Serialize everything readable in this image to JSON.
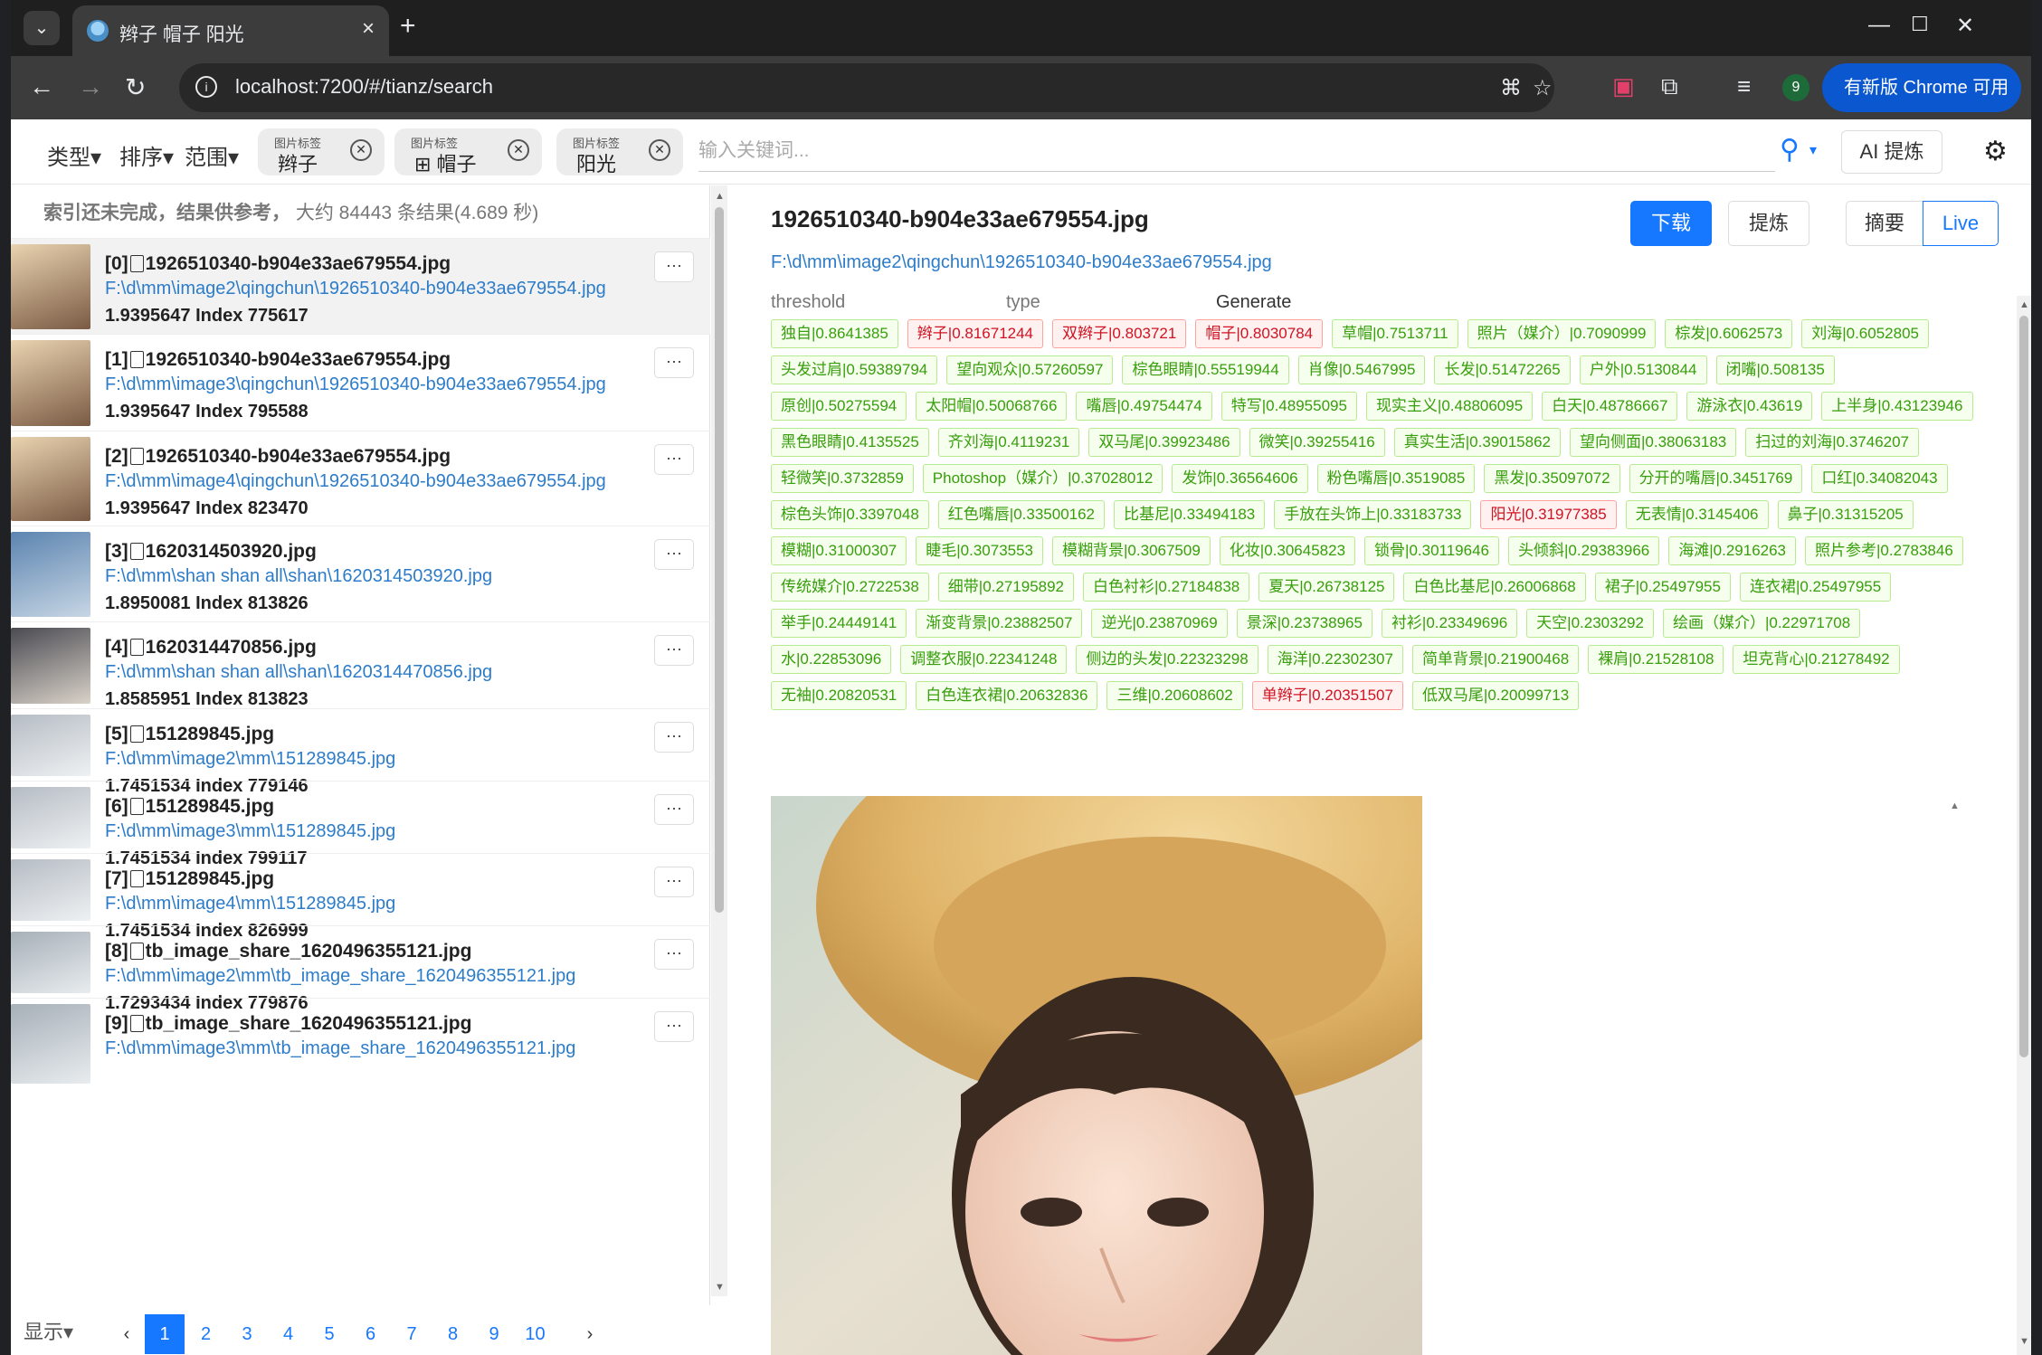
{
  "browser": {
    "tab_title": "辫子 帽子 阳光",
    "url": "localhost:7200/#/tianz/search",
    "update_label": "有新版 Chrome 可用",
    "profile_initial": "9"
  },
  "header": {
    "type_label": "类型",
    "sort_label": "排序",
    "range_label": "范围",
    "chips": [
      {
        "caption": "图片标签",
        "value": "辫子"
      },
      {
        "caption": "图片标签",
        "value": "⊞ 帽子"
      },
      {
        "caption": "图片标签",
        "value": "阳光"
      }
    ],
    "search_placeholder": "输入关键词...",
    "ai_label": "AI 提炼"
  },
  "left": {
    "status": "索引还未完成，结果供参考，",
    "status_count": "大约 84443 条结果(4.689 秒)",
    "results": [
      {
        "title": "[0]",
        "file": "1926510340-b904e33ae679554.jpg",
        "path": "F:\\d\\mm\\image2\\qingchun\\1926510340-b904e33ae679554.jpg",
        "score": "1.9395647 Index 775617"
      },
      {
        "title": "[1]",
        "file": "1926510340-b904e33ae679554.jpg",
        "path": "F:\\d\\mm\\image3\\qingchun\\1926510340-b904e33ae679554.jpg",
        "score": "1.9395647 Index 795588"
      },
      {
        "title": "[2]",
        "file": "1926510340-b904e33ae679554.jpg",
        "path": "F:\\d\\mm\\image4\\qingchun\\1926510340-b904e33ae679554.jpg",
        "score": "1.9395647 Index 823470"
      },
      {
        "title": "[3]",
        "file": "1620314503920.jpg",
        "path": "F:\\d\\mm\\shan shan all\\shan\\1620314503920.jpg",
        "score": "1.8950081 Index 813826"
      },
      {
        "title": "[4]",
        "file": "1620314470856.jpg",
        "path": "F:\\d\\mm\\shan shan all\\shan\\1620314470856.jpg",
        "score": "1.8585951 Index 813823"
      },
      {
        "title": "[5]",
        "file": "151289845.jpg",
        "path": "F:\\d\\mm\\image2\\mm\\151289845.jpg",
        "score": "1.7451534 Index 779146"
      },
      {
        "title": "[6]",
        "file": "151289845.jpg",
        "path": "F:\\d\\mm\\image3\\mm\\151289845.jpg",
        "score": "1.7451534 Index 799117"
      },
      {
        "title": "[7]",
        "file": "151289845.jpg",
        "path": "F:\\d\\mm\\image4\\mm\\151289845.jpg",
        "score": "1.7451534 Index 826999"
      },
      {
        "title": "[8]",
        "file": "tb_image_share_1620496355121.jpg",
        "path": "F:\\d\\mm\\image2\\mm\\tb_image_share_1620496355121.jpg",
        "score": "1.7293434 Index 779876"
      },
      {
        "title": "[9]",
        "file": "tb_image_share_1620496355121.jpg",
        "path": "F:\\d\\mm\\image3\\mm\\tb_image_share_1620496355121.jpg",
        "score": ""
      }
    ],
    "more_label": "···",
    "show_label": "显示",
    "pages": [
      "1",
      "2",
      "3",
      "4",
      "5",
      "6",
      "7",
      "8",
      "9",
      "10"
    ]
  },
  "detail": {
    "title": "1926510340-b904e33ae679554.jpg",
    "path": "F:\\d\\mm\\image2\\qingchun\\1926510340-b904e33ae679554.jpg",
    "download_label": "下载",
    "extract_label": "提炼",
    "summary_label": "摘要",
    "live_label": "Live",
    "col_threshold": "threshold",
    "col_type": "type",
    "col_generate": "Generate",
    "tags": [
      {
        "t": "独自|0.8641385",
        "r": false
      },
      {
        "t": "辫子|0.81671244",
        "r": true
      },
      {
        "t": "双辫子|0.803721",
        "r": true
      },
      {
        "t": "帽子|0.8030784",
        "r": true
      },
      {
        "t": "草帽|0.7513711",
        "r": false
      },
      {
        "t": "照片（媒介）|0.7090999",
        "r": false
      },
      {
        "t": "棕发|0.6062573",
        "r": false
      },
      {
        "t": "刘海|0.6052805",
        "r": false
      },
      {
        "t": "头发过肩|0.59389794",
        "r": false
      },
      {
        "t": "望向观众|0.57260597",
        "r": false
      },
      {
        "t": "棕色眼睛|0.55519944",
        "r": false
      },
      {
        "t": "肖像|0.5467995",
        "r": false
      },
      {
        "t": "长发|0.51472265",
        "r": false
      },
      {
        "t": "户外|0.5130844",
        "r": false
      },
      {
        "t": "闭嘴|0.508135",
        "r": false
      },
      {
        "t": "原创|0.50275594",
        "r": false
      },
      {
        "t": "太阳帽|0.50068766",
        "r": false
      },
      {
        "t": "嘴唇|0.49754474",
        "r": false
      },
      {
        "t": "特写|0.48955095",
        "r": false
      },
      {
        "t": "现实主义|0.48806095",
        "r": false
      },
      {
        "t": "白天|0.48786667",
        "r": false
      },
      {
        "t": "游泳衣|0.43619",
        "r": false
      },
      {
        "t": "上半身|0.43123946",
        "r": false
      },
      {
        "t": "黑色眼睛|0.4135525",
        "r": false
      },
      {
        "t": "齐刘海|0.4119231",
        "r": false
      },
      {
        "t": "双马尾|0.39923486",
        "r": false
      },
      {
        "t": "微笑|0.39255416",
        "r": false
      },
      {
        "t": "真实生活|0.39015862",
        "r": false
      },
      {
        "t": "望向侧面|0.38063183",
        "r": false
      },
      {
        "t": "扫过的刘海|0.3746207",
        "r": false
      },
      {
        "t": "轻微笑|0.3732859",
        "r": false
      },
      {
        "t": "Photoshop（媒介）|0.37028012",
        "r": false
      },
      {
        "t": "发饰|0.36564606",
        "r": false
      },
      {
        "t": "粉色嘴唇|0.3519085",
        "r": false
      },
      {
        "t": "黑发|0.35097072",
        "r": false
      },
      {
        "t": "分开的嘴唇|0.3451769",
        "r": false
      },
      {
        "t": "口红|0.34082043",
        "r": false
      },
      {
        "t": "棕色头饰|0.3397048",
        "r": false
      },
      {
        "t": "红色嘴唇|0.33500162",
        "r": false
      },
      {
        "t": "比基尼|0.33494183",
        "r": false
      },
      {
        "t": "手放在头饰上|0.33183733",
        "r": false
      },
      {
        "t": "阳光|0.31977385",
        "r": true
      },
      {
        "t": "无表情|0.3145406",
        "r": false
      },
      {
        "t": "鼻子|0.31315205",
        "r": false
      },
      {
        "t": "模糊|0.31000307",
        "r": false
      },
      {
        "t": "睫毛|0.3073553",
        "r": false
      },
      {
        "t": "模糊背景|0.3067509",
        "r": false
      },
      {
        "t": "化妆|0.30645823",
        "r": false
      },
      {
        "t": "锁骨|0.30119646",
        "r": false
      },
      {
        "t": "头倾斜|0.29383966",
        "r": false
      },
      {
        "t": "海滩|0.2916263",
        "r": false
      },
      {
        "t": "照片参考|0.2783846",
        "r": false
      },
      {
        "t": "传统媒介|0.2722538",
        "r": false
      },
      {
        "t": "细带|0.27195892",
        "r": false
      },
      {
        "t": "白色衬衫|0.27184838",
        "r": false
      },
      {
        "t": "夏天|0.26738125",
        "r": false
      },
      {
        "t": "白色比基尼|0.26006868",
        "r": false
      },
      {
        "t": "裙子|0.25497955",
        "r": false
      },
      {
        "t": "连衣裙|0.25497955",
        "r": false
      },
      {
        "t": "举手|0.24449141",
        "r": false
      },
      {
        "t": "渐变背景|0.23882507",
        "r": false
      },
      {
        "t": "逆光|0.23870969",
        "r": false
      },
      {
        "t": "景深|0.23738965",
        "r": false
      },
      {
        "t": "衬衫|0.23349696",
        "r": false
      },
      {
        "t": "天空|0.2303292",
        "r": false
      },
      {
        "t": "绘画（媒介）|0.22971708",
        "r": false
      },
      {
        "t": "水|0.22853096",
        "r": false
      },
      {
        "t": "调整衣服|0.22341248",
        "r": false
      },
      {
        "t": "侧边的头发|0.22323298",
        "r": false
      },
      {
        "t": "海洋|0.22302307",
        "r": false
      },
      {
        "t": "简单背景|0.21900468",
        "r": false
      },
      {
        "t": "裸肩|0.21528108",
        "r": false
      },
      {
        "t": "坦克背心|0.21278492",
        "r": false
      },
      {
        "t": "无袖|0.20820531",
        "r": false
      },
      {
        "t": "白色连衣裙|0.20632836",
        "r": false
      },
      {
        "t": "三维|0.20608602",
        "r": false
      },
      {
        "t": "单辫子|0.20351507",
        "r": true
      },
      {
        "t": "低双马尾|0.20099713",
        "r": false
      }
    ]
  }
}
